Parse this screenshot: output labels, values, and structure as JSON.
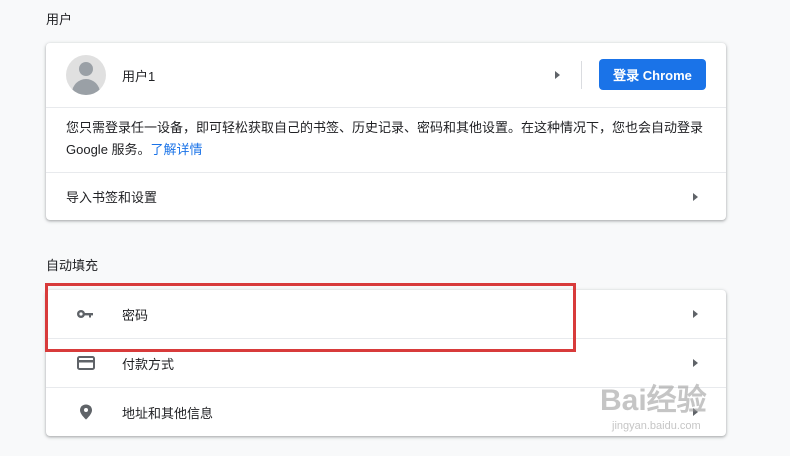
{
  "people": {
    "section_title": "用户",
    "account_name": "用户1",
    "signin_button": "登录 Chrome",
    "description": "您只需登录任一设备，即可轻松获取自己的书签、历史记录、密码和其他设置。在这种情况下，您也会自动登录 Google 服务。",
    "learn_more": "了解详情",
    "import_label": "导入书签和设置"
  },
  "autofill": {
    "section_title": "自动填充",
    "items": [
      {
        "label": "密码",
        "icon": "key-icon"
      },
      {
        "label": "付款方式",
        "icon": "credit-card-icon"
      },
      {
        "label": "地址和其他信息",
        "icon": "location-pin-icon"
      }
    ]
  },
  "watermark": {
    "text": "Bai经验",
    "sub": "jingyan.baidu.com"
  },
  "colors": {
    "accent": "#1a73e8",
    "highlight": "#d83b3b"
  }
}
